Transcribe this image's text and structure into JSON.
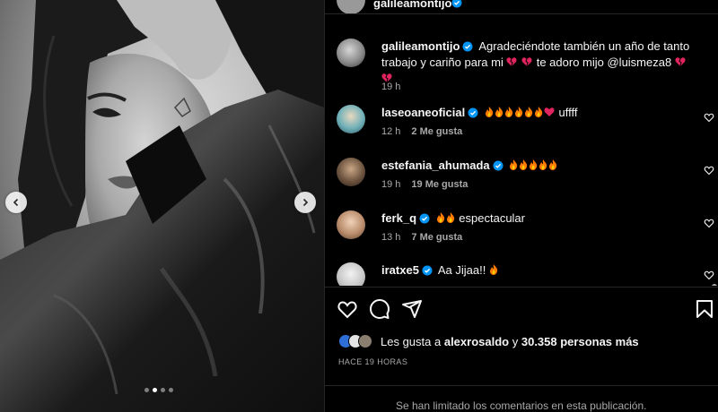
{
  "post": {
    "author": "galileamontijo",
    "caption": {
      "username": "galileamontijo",
      "text": "Agradeciéndote también un año de tanto trabajo y cariño para mi",
      "text_end": "te adoro mijo @luismeza8",
      "time": "19 h"
    },
    "carousel": {
      "slides": 4,
      "active_index": 1
    }
  },
  "comments": [
    {
      "username": "laseoaneoficial",
      "verified": true,
      "text": "uffff",
      "time": "12 h",
      "likes": "2 Me gusta"
    },
    {
      "username": "estefania_ahumada",
      "verified": true,
      "text": "",
      "time": "19 h",
      "likes": "19 Me gusta"
    },
    {
      "username": "ferk_q",
      "verified": true,
      "text": "espectacular",
      "time": "13 h",
      "likes": "7 Me gusta"
    },
    {
      "username": "iratxe5",
      "verified": true,
      "text": "Aa Jijaa!!",
      "time": "",
      "likes": ""
    }
  ],
  "actions": {
    "like_icon": "heart-icon",
    "comment_icon": "comment-icon",
    "share_icon": "share-icon",
    "save_icon": "bookmark-icon"
  },
  "likes_summary": {
    "prefix": "Les gusta a",
    "user": "alexrosaldo",
    "connector": "y",
    "count": "30.358 personas más"
  },
  "posted_ago": "HACE 19 HORAS",
  "comments_limited": "Se han limitado los comentarios en esta publicación.",
  "colors": {
    "background": "#000000",
    "text": "#f5f5f5",
    "secondary": "#a8a8a8",
    "verified": "#0095f6",
    "divider": "#262626"
  }
}
